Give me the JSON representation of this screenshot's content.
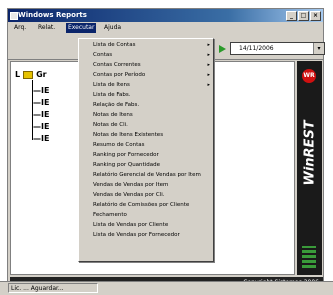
{
  "window": {
    "title": "Windows Reports"
  },
  "titlebar": {
    "buttons": [
      "_",
      "□",
      "×"
    ]
  },
  "menubar": {
    "items": [
      "Arq.",
      "Relat.",
      "Executar",
      "Ajuda"
    ]
  },
  "toolbar": {
    "combo_value": "14/11/2006",
    "combo_arrow": "▾"
  },
  "tree": {
    "root_label": "Gr",
    "children": [
      "IE",
      "IE",
      "IE",
      "IE",
      "IE"
    ]
  },
  "menu": {
    "items": [
      {
        "label": "Lista de Contas"
      },
      {
        "label": "Contas"
      },
      {
        "label": "Contas Correntes"
      },
      {
        "label": "Contas por Período"
      },
      {
        "label": "Lista de Itens"
      },
      {
        "label": "Lista de Fabs."
      },
      {
        "label": "Relação de Fabs."
      },
      {
        "label": "Notas de Itens"
      },
      {
        "label": "Notas de Cli."
      },
      {
        "label": "Notas de Itens Existentes"
      },
      {
        "label": "Resumo de Contas"
      },
      {
        "label": "Ranking por Fornecedor"
      },
      {
        "label": "Ranking por Quantidade"
      },
      {
        "label": "Relatório Gerencial de Vendas por Item"
      },
      {
        "label": "Vendas de Vendas por Item"
      },
      {
        "label": "Vendas de Vendas por Cli."
      },
      {
        "label": "Relatório de Comissões por Cliente"
      },
      {
        "label": "Fechamento"
      },
      {
        "label": "Lista de Vendas por Cliente"
      },
      {
        "label": "Lista de Vendas por Fornecedor"
      }
    ],
    "submenu_arrow": "▸"
  },
  "brand": {
    "name": "WinREST",
    "logo": "WR"
  },
  "footer": {
    "copyright": "Copyright Sistemas 2006"
  },
  "statusbar": {
    "text": "Lic. ... Aguardar..."
  },
  "colors": {
    "title_bg": "#0a246a",
    "window_bg": "#d4d0c8",
    "brand_panel": "#1a1a1a",
    "accent_red": "#d01010"
  }
}
